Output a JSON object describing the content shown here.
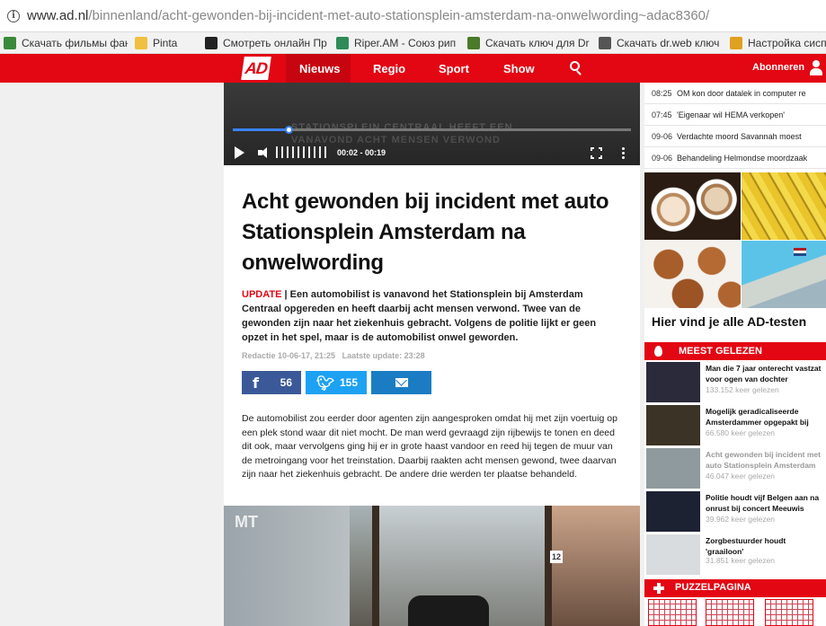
{
  "browser": {
    "url_host": "www.ad.nl",
    "url_path": "/binnenland/acht-gewonden-bij-incident-met-auto-stationsplein-amsterdam-na-onwelwording~adac8360/",
    "bookmarks": [
      {
        "label": "Скачать фильмы фан",
        "color": "#3a8a3a"
      },
      {
        "label": "Pinta",
        "color": "#f0c040"
      },
      {
        "label": "Смотреть онлайн Пр",
        "color": "#222222"
      },
      {
        "label": "Riper.AM - Союз рип",
        "color": "#2e8b57"
      },
      {
        "label": "Скачать ключ для Dr",
        "color": "#4a7a2a"
      },
      {
        "label": "Скачать dr.web ключ",
        "color": "#555555"
      },
      {
        "label": "Настройка сисп",
        "color": "#e0a020"
      }
    ]
  },
  "nav": {
    "logo": "AD",
    "items": [
      "Nieuws",
      "Regio",
      "Sport",
      "Show"
    ],
    "subscribe": "Abonneren"
  },
  "video": {
    "ghost_line1": "STATIONSPLEIN CENTRAAL HEEFT EEN",
    "ghost_line2": "VANAVOND ACHT MENSEN VERWOND",
    "time": "00:02 - 00:19",
    "progress": 0.14
  },
  "article": {
    "title": "Acht gewonden bij incident met auto Stationsplein Amsterdam na onwelwording",
    "update_tag": "UPDATE",
    "lead": "Een automobilist is vanavond het Stationsplein bij Amsterdam Centraal opgereden en heeft daarbij acht mensen verwond. Twee van de gewonden zijn naar het ziekenhuis gebracht. Volgens de politie lijkt er geen opzet in het spel, maar is de automobilist onwel geworden.",
    "meta_author": "Redactie 10-06-17, 21:25",
    "meta_update": "Laatste update: 23:28",
    "share_facebook": "56",
    "share_twitter": "155",
    "body": "De automobilist zou eerder door agenten zijn aangesproken omdat hij met zijn voertuig op een plek stond waar dit niet mocht. De man werd gevraagd zijn rijbewijs te tonen en deed dit ook, maar vervolgens ging hij er in grote haast vandoor en reed hij tegen de muur van de metroingang voor het treinstation. Daarbij raakten acht mensen gewond, twee daarvan zijn naar het ziekenhuis gebracht. De andere drie werden ter plaatse behandeld.",
    "photo_sign": "12",
    "photo_mt": "MT"
  },
  "sidebar": {
    "news": [
      {
        "time": "08:25",
        "text": "OM kon door datalek in computer re"
      },
      {
        "time": "07:45",
        "text": "'Eigenaar wil HEMA verkopen'"
      },
      {
        "time": "09-06",
        "text": "Verdachte moord Savannah moest"
      },
      {
        "time": "09-06",
        "text": "Behandeling Helmondse moordzaak"
      }
    ],
    "tests_title": "Hier vind je alle AD-testen",
    "most_read_title": "MEEST GELEZEN",
    "most_read": [
      {
        "headline": "Man die 7 jaar onterecht vastzat voor ogen van dochter",
        "count": "133.152 keer gelezen",
        "dim": false,
        "thumb": "#2a2a3a"
      },
      {
        "headline": "Mogelijk geradicaliseerde Amsterdammer opgepakt bij",
        "count": "66.580 keer gelezen",
        "dim": false,
        "thumb": "#3b3326"
      },
      {
        "headline": "Acht gewonden bij incident met auto Stationsplein Amsterdam",
        "count": "46.047 keer gelezen",
        "dim": true,
        "thumb": "#8e9a9e"
      },
      {
        "headline": "Politie houdt vijf Belgen aan na onrust bij concert Meeuwis",
        "count": "39.962 keer gelezen",
        "dim": false,
        "thumb": "#1d2233"
      },
      {
        "headline": "Zorgbestuurder houdt 'graailoon'",
        "count": "31.851 keer gelezen",
        "dim": false,
        "thumb": "#d9dcdf"
      }
    ],
    "puzzle_title": "PUZZELPAGINA"
  }
}
